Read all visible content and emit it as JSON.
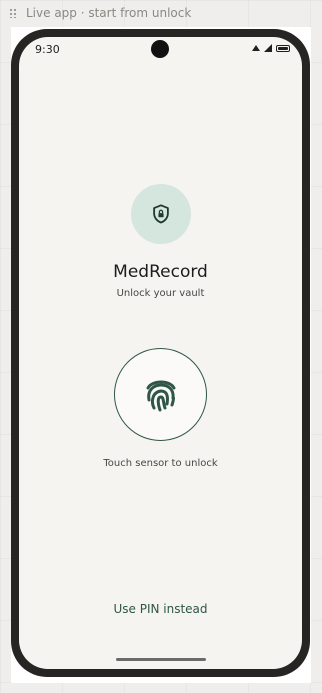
{
  "window": {
    "caption": "Live app · start from unlock"
  },
  "status_bar": {
    "time": "9:30",
    "icons": [
      "wifi-icon",
      "signal-icon",
      "battery-icon"
    ]
  },
  "app": {
    "title": "MedRecord",
    "subtitle": "Unlock your vault",
    "logo_icon": "shield-lock-icon"
  },
  "unlock": {
    "fingerprint_icon": "fingerprint-icon",
    "hint": "Touch sensor to unlock",
    "pin_label": "Use PIN instead"
  },
  "colors": {
    "accent": "#2f5646",
    "icon_bg": "#d5e6de",
    "screen_bg": "#f5f4f1",
    "frame": "#262523"
  }
}
